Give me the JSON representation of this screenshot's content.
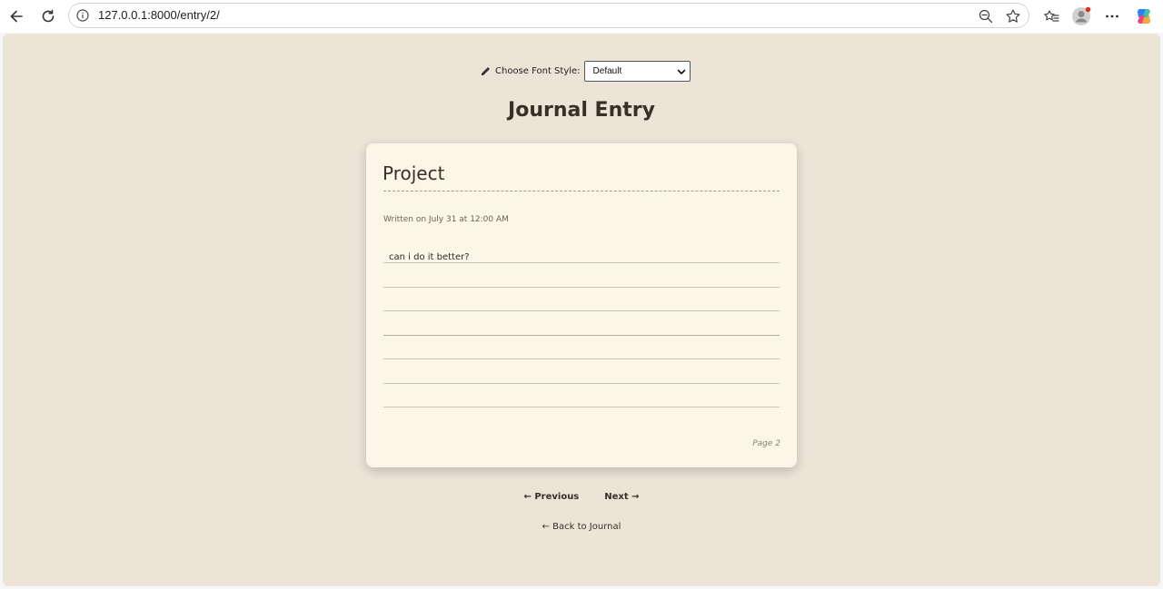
{
  "browser": {
    "url": "127.0.0.1:8000/entry/2/"
  },
  "controls": {
    "font_label": "Choose Font Style:",
    "font_selected": "Default"
  },
  "page": {
    "title": "Journal Entry"
  },
  "entry": {
    "title": "Project",
    "written": "Written on July 31 at 12:00 AM",
    "body": "can i do it better?",
    "page_number": "Page 2"
  },
  "navigation": {
    "previous": "← Previous",
    "next": "Next →",
    "back": "← Back to Journal"
  },
  "icons": {
    "back": "arrow-left-icon",
    "reload": "reload-icon",
    "info": "info-icon",
    "zoom": "zoom-out-icon",
    "favorite": "star-icon",
    "collections": "favorites-icon",
    "profile": "avatar-icon",
    "more": "more-icon",
    "copilot": "copilot-icon",
    "pencil": "pencil-icon"
  },
  "colors": {
    "page_bg": "#ebe4d7",
    "card_bg": "#fcf6e8",
    "text": "#3a2f24"
  }
}
